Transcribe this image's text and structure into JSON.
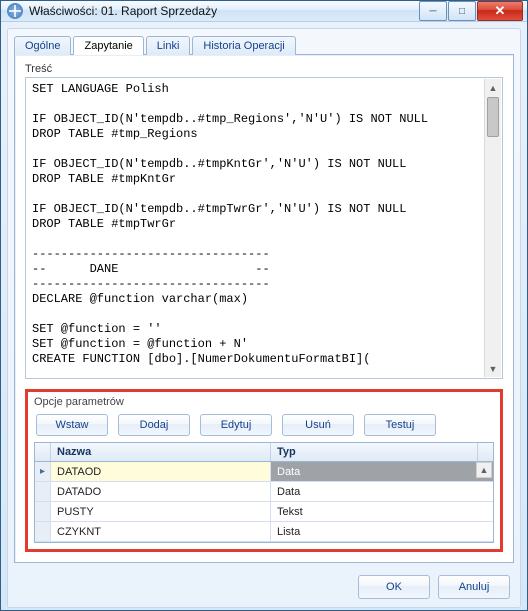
{
  "window": {
    "title": "Właściwości: 01. Raport Sprzedaży"
  },
  "tabs": [
    {
      "label": "Ogólne"
    },
    {
      "label": "Zapytanie"
    },
    {
      "label": "Linki"
    },
    {
      "label": "Historia Operacji"
    }
  ],
  "active_tab_index": 1,
  "editor": {
    "label": "Treść",
    "content": "SET LANGUAGE Polish\n\nIF OBJECT_ID(N'tempdb..#tmp_Regions','N'U') IS NOT NULL\nDROP TABLE #tmp_Regions\n\nIF OBJECT_ID(N'tempdb..#tmpKntGr','N'U') IS NOT NULL\nDROP TABLE #tmpKntGr\n\nIF OBJECT_ID(N'tempdb..#tmpTwrGr','N'U') IS NOT NULL\nDROP TABLE #tmpTwrGr\n\n---------------------------------\n--      DANE                   --\n---------------------------------\nDECLARE @function varchar(max)\n\nSET @function = ''\nSET @function = @function + N'\nCREATE FUNCTION [dbo].[NumerDokumentuFormatBI]("
  },
  "params": {
    "title": "Opcje parametrów",
    "buttons": {
      "insert": "Wstaw",
      "add": "Dodaj",
      "edit": "Edytuj",
      "delete": "Usuń",
      "test": "Testuj"
    },
    "columns": {
      "name": "Nazwa",
      "type": "Typ"
    },
    "rows": [
      {
        "name": "DATAOD",
        "type": "Data"
      },
      {
        "name": "DATADO",
        "type": "Data"
      },
      {
        "name": "PUSTY",
        "type": "Tekst"
      },
      {
        "name": "CZYKNT",
        "type": "Lista"
      }
    ],
    "selected_row_index": 0
  },
  "footer": {
    "ok": "OK",
    "cancel": "Anuluj"
  }
}
